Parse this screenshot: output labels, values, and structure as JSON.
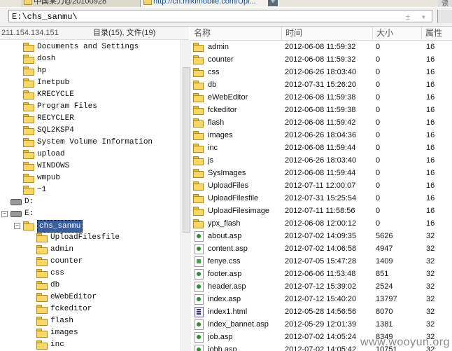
{
  "tabs": [
    {
      "label": "中国某力@20100928"
    },
    {
      "label": "http://cn.mikimobile.com/Upl..."
    }
  ],
  "new_tab_label": "+",
  "tab_right_label": "读",
  "address": {
    "value": "E:\\chs_sanmu\\",
    "buttons": "± ▾",
    "go_label": ""
  },
  "left_status": {
    "ip": "211.154.134.151",
    "counts": "目录(15), 文件(19)"
  },
  "tree": [
    {
      "label": "Documents and Settings",
      "type": "folder",
      "indent": 1
    },
    {
      "label": "dosh",
      "type": "folder",
      "indent": 1
    },
    {
      "label": "hp",
      "type": "folder",
      "indent": 1
    },
    {
      "label": "Inetpub",
      "type": "folder",
      "indent": 1
    },
    {
      "label": "KRECYCLE",
      "type": "folder",
      "indent": 1
    },
    {
      "label": "Program Files",
      "type": "folder",
      "indent": 1
    },
    {
      "label": "RECYCLER",
      "type": "folder",
      "indent": 1
    },
    {
      "label": "SQL2KSP4",
      "type": "folder",
      "indent": 1
    },
    {
      "label": "System Volume Information",
      "type": "folder",
      "indent": 1
    },
    {
      "label": "upload",
      "type": "folder",
      "indent": 1
    },
    {
      "label": "WINDOWS",
      "type": "folder",
      "indent": 1
    },
    {
      "label": "wmpub",
      "type": "folder",
      "indent": 1
    },
    {
      "label": "~1",
      "type": "folder",
      "indent": 1
    },
    {
      "label": "D:",
      "type": "drive",
      "indent": 0
    },
    {
      "label": "E:",
      "type": "drive",
      "indent": 0,
      "expanded": true
    },
    {
      "label": "chs_sanmu",
      "type": "folder",
      "indent": 1,
      "selected": true,
      "expanded": true
    },
    {
      "label": "UploadFilesfile",
      "type": "folder",
      "indent": 2
    },
    {
      "label": "admin",
      "type": "folder",
      "indent": 2
    },
    {
      "label": "counter",
      "type": "folder",
      "indent": 2
    },
    {
      "label": "css",
      "type": "folder",
      "indent": 2
    },
    {
      "label": "db",
      "type": "folder",
      "indent": 2
    },
    {
      "label": "eWebEditor",
      "type": "folder",
      "indent": 2
    },
    {
      "label": "fckeditor",
      "type": "folder",
      "indent": 2
    },
    {
      "label": "flash",
      "type": "folder",
      "indent": 2
    },
    {
      "label": "images",
      "type": "folder",
      "indent": 2
    },
    {
      "label": "inc",
      "type": "folder",
      "indent": 2
    }
  ],
  "list_header": {
    "name": "名称",
    "time": "时间",
    "size": "大小",
    "attr": "属性"
  },
  "files": [
    {
      "name": "admin",
      "time": "2012-06-08 11:59:32",
      "size": "0",
      "attr": "16",
      "icon": "folder"
    },
    {
      "name": "counter",
      "time": "2012-06-08 11:59:32",
      "size": "0",
      "attr": "16",
      "icon": "folder"
    },
    {
      "name": "css",
      "time": "2012-06-26 18:03:40",
      "size": "0",
      "attr": "16",
      "icon": "folder"
    },
    {
      "name": "db",
      "time": "2012-07-31 15:26:20",
      "size": "0",
      "attr": "16",
      "icon": "folder"
    },
    {
      "name": "eWebEditor",
      "time": "2012-06-08 11:59:38",
      "size": "0",
      "attr": "16",
      "icon": "folder"
    },
    {
      "name": "fckeditor",
      "time": "2012-06-08 11:59:38",
      "size": "0",
      "attr": "16",
      "icon": "folder"
    },
    {
      "name": "flash",
      "time": "2012-06-08 11:59:42",
      "size": "0",
      "attr": "16",
      "icon": "folder"
    },
    {
      "name": "images",
      "time": "2012-06-26 18:04:36",
      "size": "0",
      "attr": "16",
      "icon": "folder"
    },
    {
      "name": "inc",
      "time": "2012-06-08 11:59:44",
      "size": "0",
      "attr": "16",
      "icon": "folder"
    },
    {
      "name": "js",
      "time": "2012-06-26 18:03:40",
      "size": "0",
      "attr": "16",
      "icon": "folder"
    },
    {
      "name": "SysImages",
      "time": "2012-06-08 11:59:44",
      "size": "0",
      "attr": "16",
      "icon": "folder"
    },
    {
      "name": "UploadFiles",
      "time": "2012-07-11 12:00:07",
      "size": "0",
      "attr": "16",
      "icon": "folder"
    },
    {
      "name": "UploadFilesfile",
      "time": "2012-07-31 15:25:54",
      "size": "0",
      "attr": "16",
      "icon": "folder"
    },
    {
      "name": "UploadFilesimage",
      "time": "2012-07-11 11:58:56",
      "size": "0",
      "attr": "16",
      "icon": "folder"
    },
    {
      "name": "ypx_flash",
      "time": "2012-06-08 12:00:12",
      "size": "0",
      "attr": "16",
      "icon": "folder"
    },
    {
      "name": "about.asp",
      "time": "2012-07-02 14:09:35",
      "size": "5626",
      "attr": "32",
      "icon": "asp"
    },
    {
      "name": "content.asp",
      "time": "2012-07-02 14:06:58",
      "size": "4947",
      "attr": "32",
      "icon": "asp"
    },
    {
      "name": "fenye.css",
      "time": "2012-07-05 15:47:28",
      "size": "1409",
      "attr": "32",
      "icon": "css"
    },
    {
      "name": "footer.asp",
      "time": "2012-06-06 11:53:48",
      "size": "851",
      "attr": "32",
      "icon": "asp"
    },
    {
      "name": "header.asp",
      "time": "2012-07-12 15:39:02",
      "size": "2524",
      "attr": "32",
      "icon": "asp"
    },
    {
      "name": "index.asp",
      "time": "2012-07-12 15:40:20",
      "size": "13797",
      "attr": "32",
      "icon": "asp"
    },
    {
      "name": "index1.html",
      "time": "2012-05-28 14:56:56",
      "size": "8070",
      "attr": "32",
      "icon": "html"
    },
    {
      "name": "index_bannet.asp",
      "time": "2012-05-29 12:01:39",
      "size": "1381",
      "attr": "32",
      "icon": "asp"
    },
    {
      "name": "job.asp",
      "time": "2012-07-02 14:05:24",
      "size": "8349",
      "attr": "32",
      "icon": "asp"
    },
    {
      "name": "jobb.asp",
      "time": "2012-07-02 14:05:42",
      "size": "10751",
      "attr": "32",
      "icon": "asp"
    }
  ],
  "watermark": "www.wooyun.org"
}
